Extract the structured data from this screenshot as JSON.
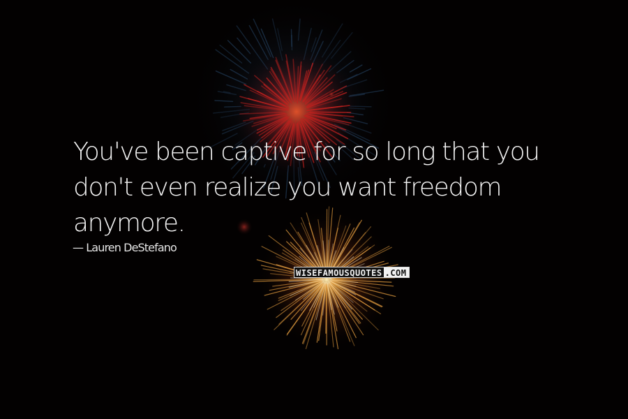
{
  "quote": {
    "text": "You've been captive for so long that you don't even realize you want freedom anymore."
  },
  "author": {
    "name": "Lauren DeStefano",
    "prefix": "— "
  },
  "watermark": {
    "brand": "WISEFAMOUSQUOTES",
    "suffix": ".COM"
  },
  "colors": {
    "background": "#030101",
    "text": "#f4f4f4",
    "firework_red": "#c2201e",
    "firework_blue": "#2a4c70",
    "firework_gold": "#e8a040"
  }
}
